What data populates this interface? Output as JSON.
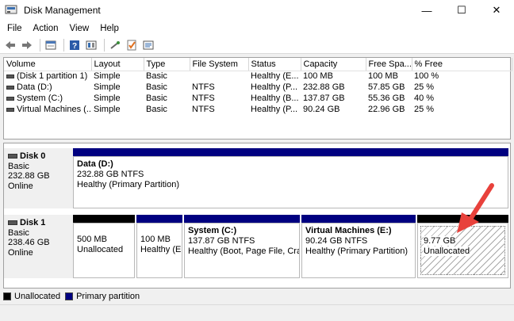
{
  "window": {
    "title": "Disk Management",
    "minimize": "—",
    "maximize": "☐",
    "close": "✕"
  },
  "menu": [
    "File",
    "Action",
    "View",
    "Help"
  ],
  "toolbar_icons": [
    "back-icon",
    "forward-icon",
    "properties-icon",
    "help-icon",
    "refresh-icon",
    "connect-icon",
    "check-icon",
    "settings-icon"
  ],
  "volumes": {
    "columns": [
      "Volume",
      "Layout",
      "Type",
      "File System",
      "Status",
      "Capacity",
      "Free Spa...",
      "% Free"
    ],
    "rows": [
      [
        "(Disk 1 partition 1)",
        "Simple",
        "Basic",
        "",
        "Healthy (E...",
        "100 MB",
        "100 MB",
        "100 %"
      ],
      [
        "Data (D:)",
        "Simple",
        "Basic",
        "NTFS",
        "Healthy (P...",
        "232.88 GB",
        "57.85 GB",
        "25 %"
      ],
      [
        "System (C:)",
        "Simple",
        "Basic",
        "NTFS",
        "Healthy (B...",
        "137.87 GB",
        "55.36 GB",
        "40 %"
      ],
      [
        "Virtual Machines (...",
        "Simple",
        "Basic",
        "NTFS",
        "Healthy (P...",
        "90.24 GB",
        "22.96 GB",
        "25 %"
      ]
    ]
  },
  "disk0": {
    "name": "Disk 0",
    "type": "Basic",
    "size": "232.88 GB",
    "state": "Online",
    "partitions": [
      {
        "title": "Data  (D:)",
        "size": "232.88 GB NTFS",
        "status": "Healthy (Primary Partition)"
      }
    ]
  },
  "disk1": {
    "name": "Disk 1",
    "type": "Basic",
    "size": "238.46 GB",
    "state": "Online",
    "partitions": [
      {
        "title": "",
        "size": "500 MB",
        "status": "Unallocated"
      },
      {
        "title": "",
        "size": "100 MB",
        "status": "Healthy (E"
      },
      {
        "title": "System  (C:)",
        "size": "137.87 GB NTFS",
        "status": "Healthy (Boot, Page File, Crash"
      },
      {
        "title": "Virtual Machines  (E:)",
        "size": "90.24 GB NTFS",
        "status": "Healthy (Primary Partition)"
      },
      {
        "title": "",
        "size": "9.77 GB",
        "status": "Unallocated"
      }
    ]
  },
  "legend": [
    {
      "label": "Unallocated",
      "color": "#000000"
    },
    {
      "label": "Primary partition",
      "color": "#000080"
    }
  ],
  "colors": {
    "primary": "#000080",
    "unallocated": "#000000",
    "arrow": "#e8413b"
  }
}
